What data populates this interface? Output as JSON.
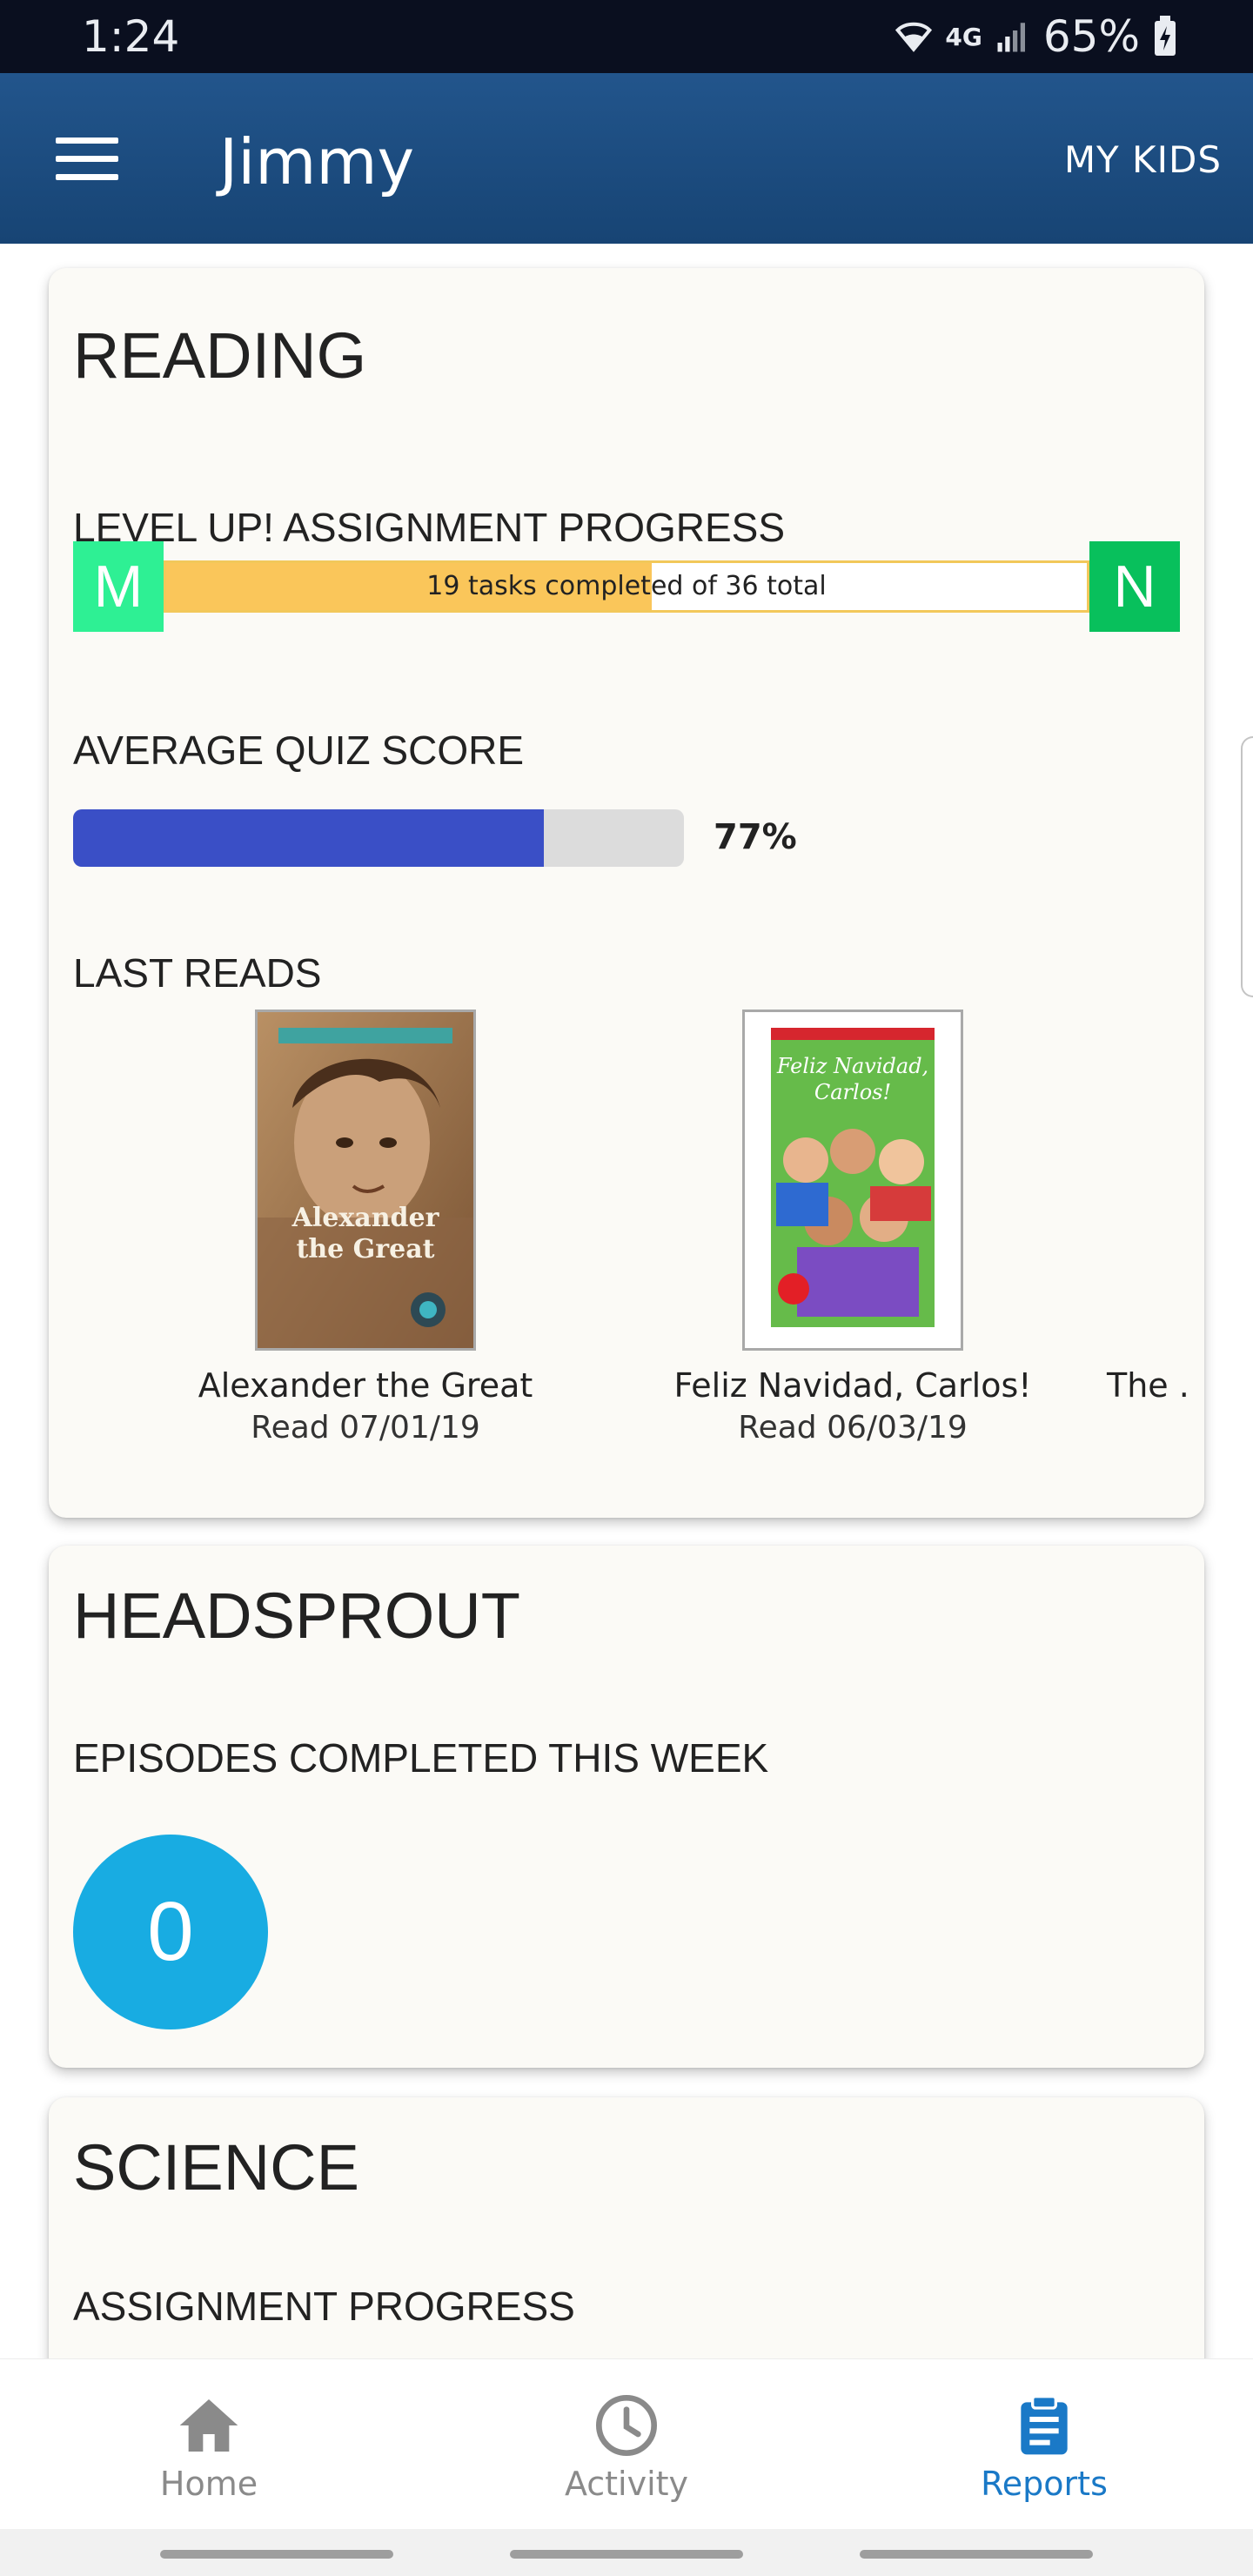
{
  "status_bar": {
    "time": "1:24",
    "network": "4G",
    "battery": "65%"
  },
  "app_bar": {
    "title": "Jimmy",
    "my_kids_label": "MY KIDS"
  },
  "reading": {
    "title": "READING",
    "level_progress": {
      "label": "LEVEL UP! ASSIGNMENT PROGRESS",
      "from_level": "M",
      "to_level": "N",
      "completed": 19,
      "total": 36,
      "text": "19 tasks completed of 36 total"
    },
    "quiz": {
      "label": "AVERAGE QUIZ SCORE",
      "value_text": "77%",
      "value": 0.77
    },
    "last_reads": {
      "label": "LAST READS",
      "books": [
        {
          "title": "Alexander the Great",
          "date": "Read 07/01/19",
          "cover_text": "Alexander the Great"
        },
        {
          "title": "Feliz Navidad, Carlos!",
          "date": "Read 06/03/19",
          "cover_text": "Feliz Navidad, Carlos!"
        },
        {
          "title": "The .",
          "date": ""
        }
      ]
    }
  },
  "headsprout": {
    "title": "HEADSPROUT",
    "episodes_label": "EPISODES COMPLETED THIS WEEK",
    "episodes_count": "0"
  },
  "science": {
    "title": "SCIENCE",
    "assignment_label": "ASSIGNMENT PROGRESS"
  },
  "bottom_nav": {
    "items": [
      {
        "label": "Home",
        "icon": "home-icon"
      },
      {
        "label": "Activity",
        "icon": "clock-icon"
      },
      {
        "label": "Reports",
        "icon": "clipboard-icon",
        "active": true
      }
    ]
  },
  "colors": {
    "app_bar": "#1c4d80",
    "level_m": "#2ef094",
    "level_n": "#08c05c",
    "level_fill": "#fac65a",
    "quiz_fill": "#3a4fc6",
    "episodes_circle": "#18ace2",
    "active_nav": "#1a79c7"
  }
}
